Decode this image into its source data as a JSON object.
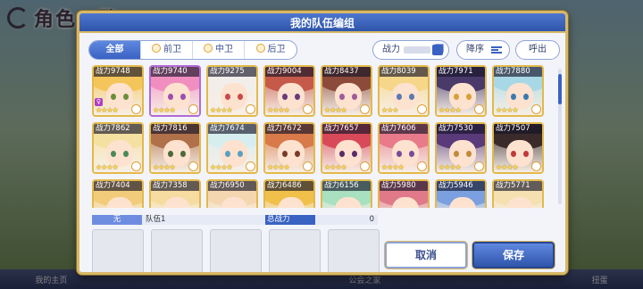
{
  "background": {
    "title": "角色一覧",
    "nav": [
      "我的主页",
      "",
      "",
      "",
      "公会之家",
      "",
      "",
      "扭蛋"
    ]
  },
  "dialog": {
    "title": "我的队伍编组"
  },
  "filters": {
    "tabs": [
      {
        "label": "全部",
        "active": true
      },
      {
        "label": "前卫",
        "active": false
      },
      {
        "label": "中卫",
        "active": false
      },
      {
        "label": "后卫",
        "active": false
      }
    ]
  },
  "sort": {
    "power_label": "战力",
    "order_label": "降序",
    "call_label": "呼出"
  },
  "characters": [
    {
      "power": "战力9748",
      "hair": "#f3c55a",
      "eye": "#6b8f3a",
      "stars": "★★★★",
      "frame": "gold",
      "rank": "♀"
    },
    {
      "power": "战力9740",
      "hair": "#f08fbf",
      "eye": "#9b4fb0",
      "stars": "★★★★",
      "frame": "purple",
      "rank": ""
    },
    {
      "power": "战力9275",
      "hair": "#f2eee9",
      "eye": "#c94a4a",
      "stars": "★★★★",
      "frame": "gold",
      "rank": ""
    },
    {
      "power": "战力9004",
      "hair": "#c65a4a",
      "eye": "#6a3a7a",
      "stars": "★★★★",
      "frame": "gold",
      "rank": ""
    },
    {
      "power": "战力8437",
      "hair": "#8c4a3a",
      "eye": "#a05a9a",
      "stars": "★★★★",
      "frame": "gold",
      "rank": ""
    },
    {
      "power": "战力8039",
      "hair": "#f6d78a",
      "eye": "#5a7ab0",
      "stars": "★★★",
      "frame": "gold",
      "rank": ""
    },
    {
      "power": "战力7971",
      "hair": "#4a3a6a",
      "eye": "#d6a03a",
      "stars": "★★★★",
      "frame": "gold",
      "rank": ""
    },
    {
      "power": "战力7880",
      "hair": "#a8d8e6",
      "eye": "#3a7ab0",
      "stars": "★★★★",
      "frame": "gold",
      "rank": ""
    },
    {
      "power": "战力7862",
      "hair": "#f4e0a0",
      "eye": "#4a8a5a",
      "stars": "★★★★",
      "frame": "gold",
      "rank": ""
    },
    {
      "power": "战力7816",
      "hair": "#b0704a",
      "eye": "#4a6a3a",
      "stars": "★★★★",
      "frame": "gold",
      "rank": ""
    },
    {
      "power": "战力7674",
      "hair": "#d6eef0",
      "eye": "#5aa0c0",
      "stars": "★★★★",
      "frame": "gold",
      "rank": ""
    },
    {
      "power": "战力7672",
      "hair": "#d87a4a",
      "eye": "#7a3a2a",
      "stars": "★★★★",
      "frame": "gold",
      "rank": ""
    },
    {
      "power": "战力7657",
      "hair": "#d84a5a",
      "eye": "#5a2a6a",
      "stars": "★★★★",
      "frame": "gold",
      "rank": ""
    },
    {
      "power": "战力7606",
      "hair": "#e87a8a",
      "eye": "#7a4a9a",
      "stars": "★★★★",
      "frame": "gold",
      "rank": ""
    },
    {
      "power": "战力7530",
      "hair": "#5a3a7a",
      "eye": "#c08a3a",
      "stars": "★★★★",
      "frame": "gold",
      "rank": ""
    },
    {
      "power": "战力7507",
      "hair": "#3a2a2a",
      "eye": "#c03a3a",
      "stars": "★★★★",
      "frame": "gold",
      "rank": ""
    },
    {
      "power": "战力7404",
      "hair": "#f2cc7a",
      "eye": "#5a7a3a",
      "stars": "",
      "frame": "gold",
      "rank": ""
    },
    {
      "power": "战力7358",
      "hair": "#f6dca0",
      "eye": "#6a4a3a",
      "stars": "",
      "frame": "gold",
      "rank": ""
    },
    {
      "power": "战力6950",
      "hair": "#f4d7b0",
      "eye": "#5a6a9a",
      "stars": "",
      "frame": "gold",
      "rank": ""
    },
    {
      "power": "战力6486",
      "hair": "#f0c04a",
      "eye": "#5a5a3a",
      "stars": "",
      "frame": "gold",
      "rank": ""
    },
    {
      "power": "战力6156",
      "hair": "#a8e0c0",
      "eye": "#3a7a5a",
      "stars": "",
      "frame": "gold",
      "rank": ""
    },
    {
      "power": "战力5980",
      "hair": "#e07a8a",
      "eye": "#6a3a5a",
      "stars": "",
      "frame": "gold",
      "rank": ""
    },
    {
      "power": "战力5946",
      "hair": "#7aa0e0",
      "eye": "#3a4a8a",
      "stars": "",
      "frame": "gold",
      "rank": ""
    },
    {
      "power": "战力5771",
      "hair": "#f4e0b0",
      "eye": "#6a5a3a",
      "stars": "",
      "frame": "gold",
      "rank": ""
    }
  ],
  "team": {
    "tag": "无",
    "name": "队伍1",
    "total_label": "总战力",
    "total_value": "0"
  },
  "buttons": {
    "cancel": "取消",
    "save": "保存"
  },
  "colors": {
    "accent": "#3a62c2",
    "frame_gold": "#e3b94b",
    "frame_purple": "#b06ad6",
    "dialog_border": "#d8b868"
  }
}
